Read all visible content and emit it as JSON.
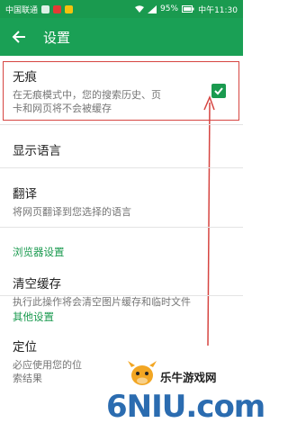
{
  "status_bar": {
    "carrier": "中国联通",
    "battery": "95%",
    "time": "中午11:30"
  },
  "toolbar": {
    "title": "设置"
  },
  "items": {
    "incognito": {
      "title": "无痕",
      "desc_line1": "在无痕模式中，您的搜索历史、页",
      "desc_line2": "卡和网页将不会被缓存",
      "checked": true
    },
    "language": {
      "title": "显示语言"
    },
    "translate": {
      "title": "翻译",
      "desc": "将网页翻译到您选择的语言"
    },
    "browser_section": "浏览器设置",
    "clear_cache": {
      "title": "清空缓存",
      "desc": "执行此操作将会清空图片缓存和临时文件"
    },
    "other_section": "其他设置",
    "location": {
      "title": "定位",
      "desc_line1": "必应使用您的位",
      "desc_line2": "索结果"
    }
  },
  "watermark": {
    "site_name": "乐牛游戏网",
    "logo_text": "6NIU.com"
  },
  "colors": {
    "accent": "#1a9a4f",
    "annotation": "#d64541"
  }
}
